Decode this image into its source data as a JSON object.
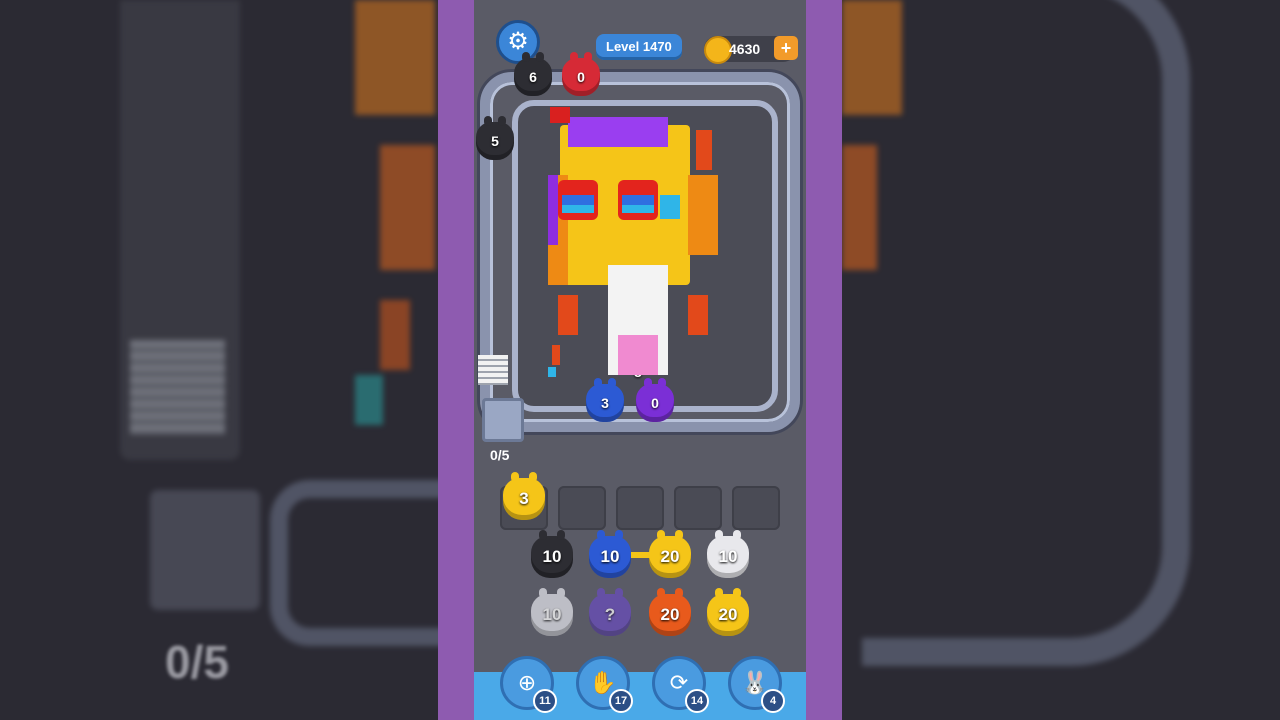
{
  "header": {
    "level_label": "Level 1470",
    "coins": "4630",
    "plus_label": "+"
  },
  "belt": {
    "top_black_count": "6",
    "top_red_count": "0",
    "left_black_count": "5",
    "bottom_blue_count": "3",
    "bottom_purple_count": "0",
    "pink_count": "8",
    "progress": "0/5"
  },
  "queue": {
    "slot_1_count": "3"
  },
  "stacks": {
    "row1": [
      "10",
      "10",
      "20",
      "10"
    ],
    "row2": [
      "10",
      "?",
      "20",
      "20"
    ]
  },
  "tools": [
    {
      "icon": "add-slot-icon",
      "count": "11"
    },
    {
      "icon": "hand-icon",
      "count": "17"
    },
    {
      "icon": "shuffle-icon",
      "count": "14"
    },
    {
      "icon": "bunny-icon",
      "count": "4"
    }
  ],
  "side_left_progress": "0/5",
  "colors": {
    "purple_border": "#8e5bb0",
    "belt": "#8a93ad",
    "tool_blue": "#4a9be0"
  }
}
